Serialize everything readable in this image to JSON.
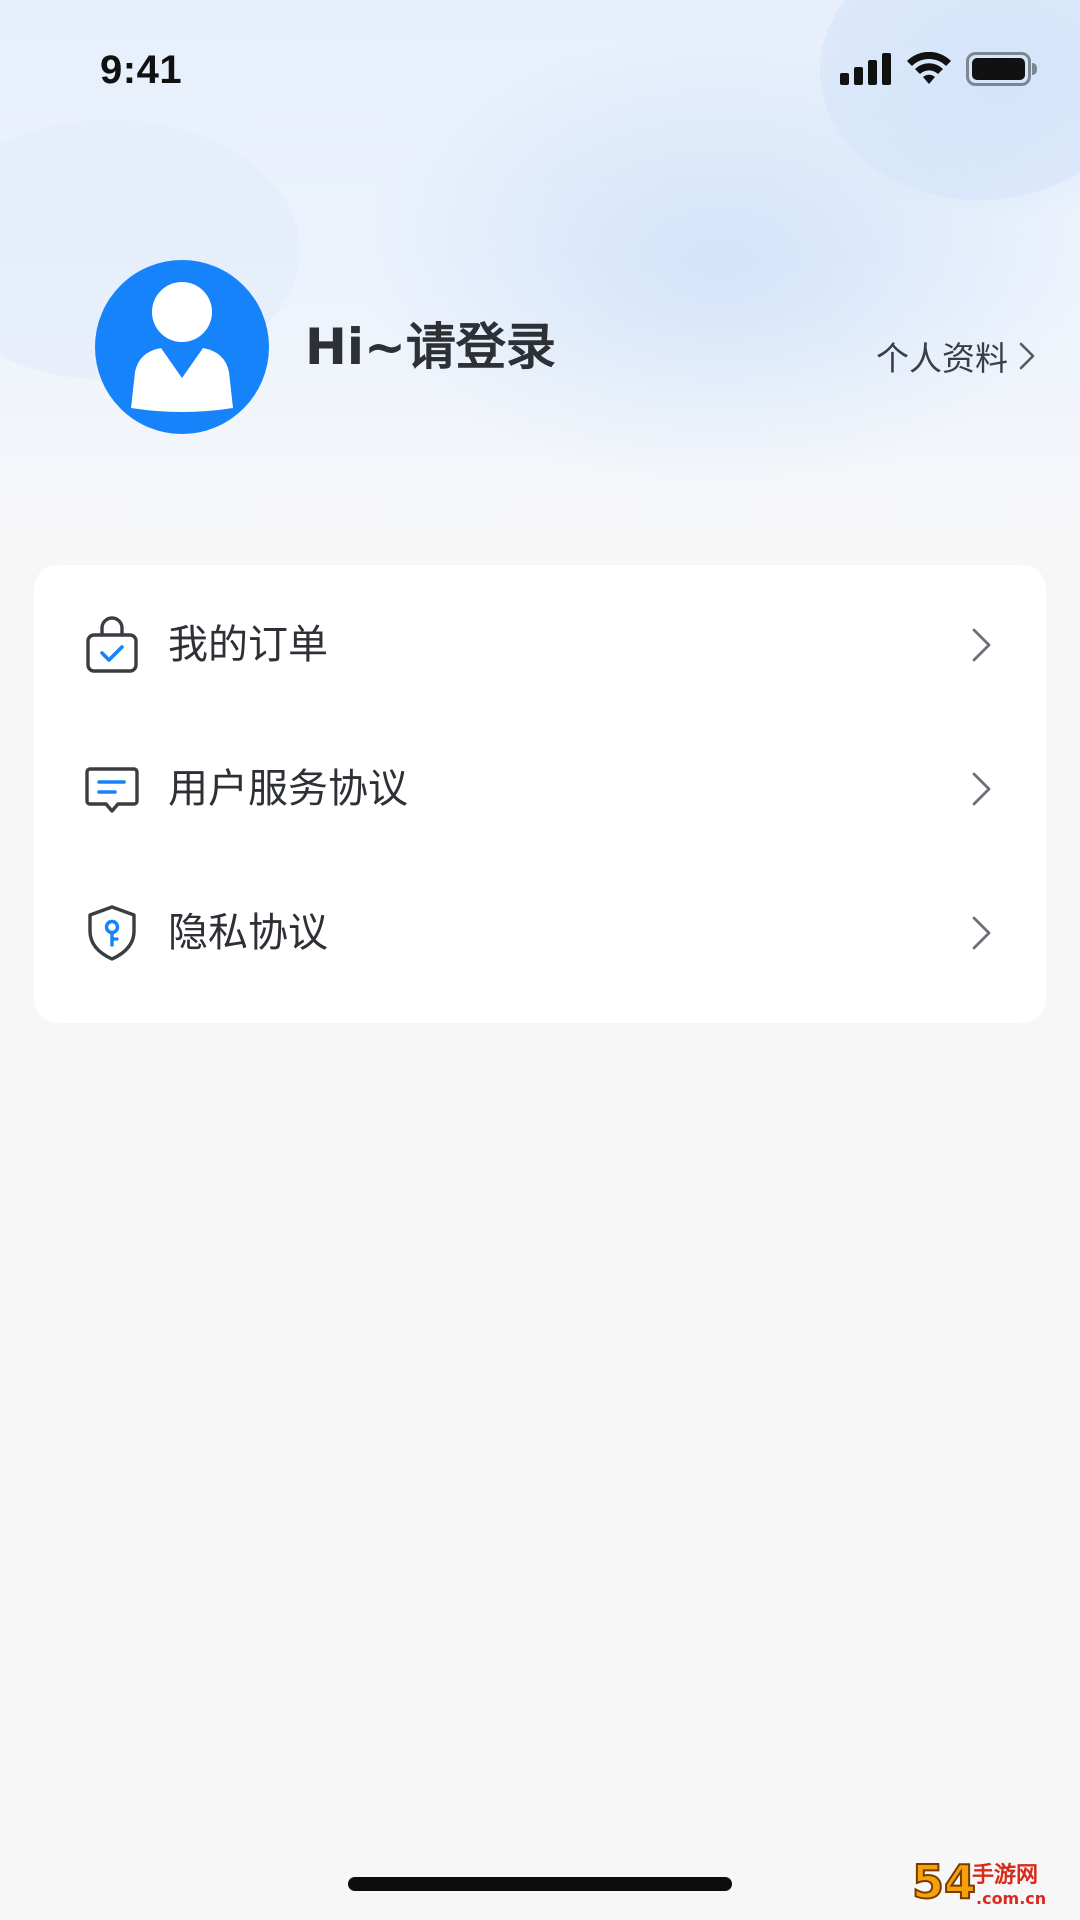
{
  "status_bar": {
    "time": "9:41",
    "icons": [
      "signal-icon",
      "wifi-icon",
      "battery-icon"
    ]
  },
  "profile": {
    "login_prompt": "Hi~请登录",
    "profile_link_label": "个人资料",
    "avatar_icon": "user-avatar-icon",
    "accent_color": "#1683fa"
  },
  "menu": {
    "items": [
      {
        "label": "我的订单",
        "icon": "shopping-bag-check-icon"
      },
      {
        "label": "用户服务协议",
        "icon": "message-document-icon"
      },
      {
        "label": "隐私协议",
        "icon": "shield-key-icon"
      }
    ]
  },
  "watermark": {
    "brand": "54",
    "text": "手游网",
    "domain": ".com.cn"
  }
}
